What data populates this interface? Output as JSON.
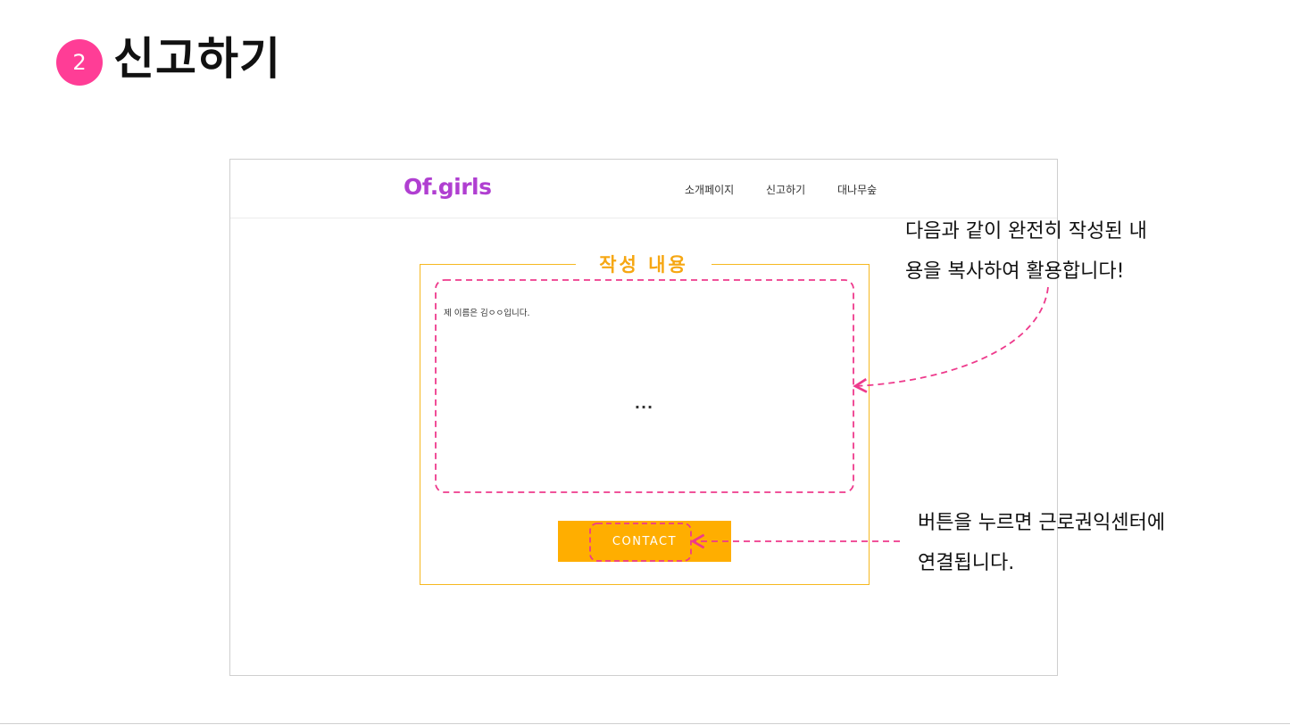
{
  "slide": {
    "step_number": "2",
    "title": "신고하기"
  },
  "site": {
    "brand": "Of.girls",
    "nav": [
      "소개페이지",
      "신고하기",
      "대나무숲"
    ],
    "section_title": "작성 내용",
    "body_text": "제 이름은 김ㅇㅇ입니다.",
    "ellipsis": "...",
    "contact_label": "CONTACT"
  },
  "annotations": {
    "content_note": [
      "다음과 같이 완전히 작성된 내",
      "용을 복사하여 활용합니다!"
    ],
    "button_note": [
      "버튼을 누르면 근로권익센터에",
      "연결됩니다."
    ]
  },
  "colors": {
    "badge": "#ff3d96",
    "brand": "#b03fd1",
    "accent_orange": "#ffae00",
    "annotation_pink": "#ee3a8c"
  }
}
